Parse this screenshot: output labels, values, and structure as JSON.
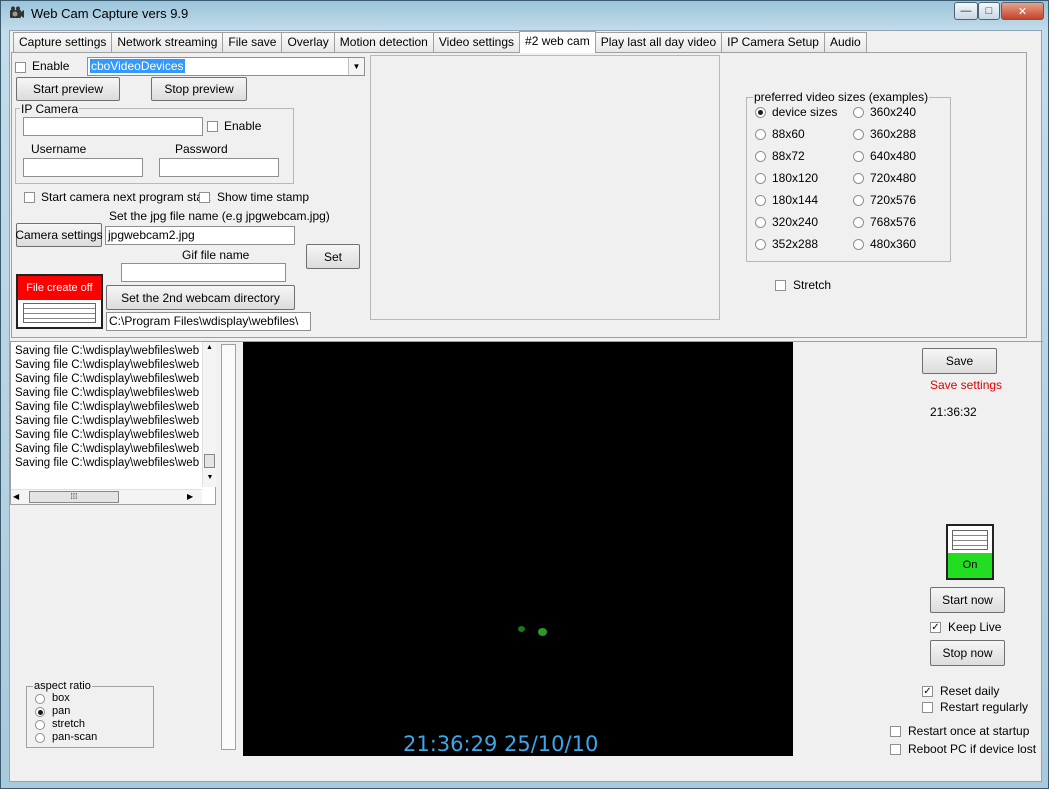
{
  "window": {
    "title": "Web Cam Capture vers 9.9",
    "minimize": "—",
    "maximize": "□",
    "close": "✕"
  },
  "tabs": [
    "Capture settings",
    "Network streaming",
    "File save",
    "Overlay",
    "Motion detection",
    "Video settings",
    "#2 web cam",
    "Play last all day video",
    "IP Camera Setup",
    "Audio"
  ],
  "webcam2": {
    "enable_label": "Enable",
    "device_value": "cboVideoDevices",
    "start_preview": "Start preview",
    "stop_preview": "Stop preview",
    "ip_camera_title": "IP Camera",
    "ip_enable_label": "Enable",
    "username_label": "Username",
    "password_label": "Password",
    "start_next_label": "Start camera next program start",
    "timestamp_label": "Show time stamp",
    "jpg_name_label": "Set the jpg file name (e.g jpgwebcam.jpg)",
    "camera_settings": "Camera settings",
    "jpg_name_value": "jpgwebcam2.jpg",
    "set_button": "Set",
    "gif_name_label": "Gif file name",
    "gif_name_value": "",
    "file_create_status": "File create off",
    "set_dir_button": "Set the 2nd webcam directory",
    "dir_value": "C:\\Program Files\\wdisplay\\webfiles\\",
    "sizes_title": "preferred video sizes (examples)",
    "sizes_left": [
      "device sizes",
      "88x60",
      "88x72",
      "180x120",
      "180x144",
      "320x240",
      "352x288"
    ],
    "sizes_right": [
      "360x240",
      "360x288",
      "640x480",
      "720x480",
      "720x576",
      "768x576",
      "480x360"
    ],
    "selected_size": "device sizes",
    "stretch_label": "Stretch"
  },
  "log": {
    "lines": [
      "Saving file C:\\wdisplay\\webfiles\\web",
      "Saving file C:\\wdisplay\\webfiles\\web",
      "Saving file C:\\wdisplay\\webfiles\\web",
      "Saving file C:\\wdisplay\\webfiles\\web",
      "Saving file C:\\wdisplay\\webfiles\\web",
      "Saving file C:\\wdisplay\\webfiles\\web",
      "Saving file C:\\wdisplay\\webfiles\\web",
      "Saving file C:\\wdisplay\\webfiles\\web",
      "Saving file C:\\wdisplay\\webfiles\\web"
    ]
  },
  "aspect": {
    "title": "aspect ratio",
    "options": [
      "box",
      "pan",
      "stretch",
      "pan-scan"
    ],
    "selected": "pan"
  },
  "video": {
    "overlay_text": "21:36:29  25/10/10"
  },
  "right_panel": {
    "save_button": "Save",
    "save_status": "Save settings",
    "clock": "21:36:32",
    "live_status": "On",
    "start_now": "Start now",
    "keep_live_label": "Keep Live",
    "keep_live_checked": true,
    "stop_now": "Stop now",
    "reset_daily_label": "Reset daily",
    "reset_daily_checked": true,
    "restart_regularly_label": "Restart regularly",
    "restart_startup_label": "Restart once at startup",
    "reboot_label": "Reboot PC if device lost"
  },
  "colors": {
    "status_off": "#ff0000",
    "status_on": "#22dd22",
    "save_status": "#e00000",
    "overlay_text": "#3aa7e8",
    "selection": "#3399ff"
  }
}
